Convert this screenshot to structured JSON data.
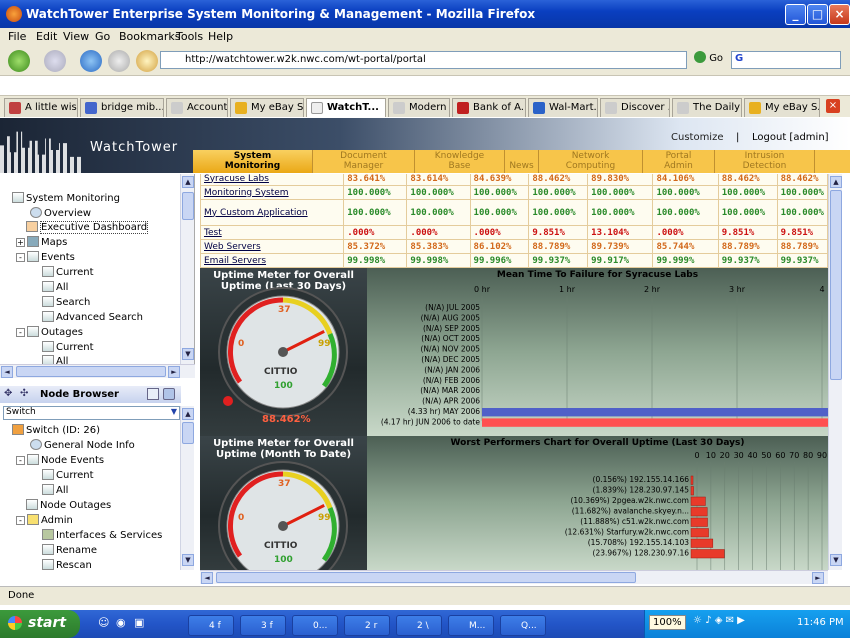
{
  "window": {
    "title": "WatchTower Enterprise System Monitoring & Management - Mozilla Firefox"
  },
  "menu": [
    "File",
    "Edit",
    "View",
    "Go",
    "Bookmarks",
    "Tools",
    "Help"
  ],
  "address": {
    "url": "http://watchtower.w2k.nwc.com/wt-portal/portal",
    "go_label": "Go",
    "search_letter": "G"
  },
  "tabs": [
    {
      "label": "A little wis..."
    },
    {
      "label": "bridge mib..."
    },
    {
      "label": "Accounts ..."
    },
    {
      "label": "My eBay S..."
    },
    {
      "label": "WatchT..."
    },
    {
      "label": "Modern Pi..."
    },
    {
      "label": "Bank of A..."
    },
    {
      "label": "Wal-Mart..."
    },
    {
      "label": "Discover ..."
    },
    {
      "label": "The Daily ..."
    },
    {
      "label": "My eBay S..."
    }
  ],
  "brand": {
    "name": "WatchTower",
    "customize": "Customize",
    "separator": "|",
    "logout": "Logout [admin]"
  },
  "nav": [
    {
      "l1": "System",
      "l2": "Monitoring",
      "active": true
    },
    {
      "l1": "Document",
      "l2": "Manager"
    },
    {
      "l1": "Knowledge",
      "l2": "Base"
    },
    {
      "l1": "",
      "l2": "News"
    },
    {
      "l1": "Network",
      "l2": "Computing"
    },
    {
      "l1": "Portal",
      "l2": "Admin"
    },
    {
      "l1": "Intrusion",
      "l2": "Detection"
    }
  ],
  "tree1": {
    "root": "System Monitoring",
    "overview": "Overview",
    "exec": "Executive Dashboard",
    "maps": "Maps",
    "events": "Events",
    "ev_current": "Current",
    "ev_all": "All",
    "ev_search": "Search",
    "ev_adv": "Advanced Search",
    "outages": "Outages",
    "out_current": "Current",
    "out_all": "All"
  },
  "node_browser": {
    "title": "Node Browser",
    "switch_value": "Switch",
    "node": "Switch (ID: 26)",
    "info": "General Node Info",
    "events": "Node Events",
    "ev_current": "Current",
    "ev_all": "All",
    "outages": "Node Outages",
    "admin": "Admin",
    "ifaces": "Interfaces & Services",
    "rename": "Rename",
    "rescan": "Rescan"
  },
  "availability": [
    {
      "name": "Syracuse Labs",
      "vals": [
        "83.641%",
        "83.614%",
        "84.639%",
        "88.462%",
        "89.830%",
        "84.106%",
        "88.462%",
        "88.462%"
      ],
      "cls": [
        "o",
        "o",
        "o",
        "o",
        "o",
        "o",
        "o",
        "o"
      ]
    },
    {
      "name": "Monitoring System",
      "vals": [
        "100.000%",
        "100.000%",
        "100.000%",
        "100.000%",
        "100.000%",
        "100.000%",
        "100.000%",
        "100.000%"
      ],
      "cls": [
        "g",
        "g",
        "g",
        "g",
        "g",
        "g",
        "g",
        "g"
      ]
    },
    {
      "name": "My Custom Application",
      "vals": [
        "100.000%",
        "100.000%",
        "100.000%",
        "100.000%",
        "100.000%",
        "100.000%",
        "100.000%",
        "100.000%"
      ],
      "cls": [
        "g",
        "g",
        "g",
        "g",
        "g",
        "g",
        "g",
        "g"
      ]
    },
    {
      "name": "Test",
      "vals": [
        ".000%",
        ".000%",
        ".000%",
        "9.851%",
        "13.104%",
        ".000%",
        "9.851%",
        "9.851%"
      ],
      "cls": [
        "r",
        "r",
        "r",
        "r",
        "r",
        "r",
        "r",
        "r"
      ]
    },
    {
      "name": "Web Servers",
      "vals": [
        "85.372%",
        "85.383%",
        "86.102%",
        "88.789%",
        "89.739%",
        "85.744%",
        "88.789%",
        "88.789%"
      ],
      "cls": [
        "o",
        "o",
        "o",
        "o",
        "o",
        "o",
        "o",
        "o"
      ]
    },
    {
      "name": "Email Servers",
      "vals": [
        "99.998%",
        "99.998%",
        "99.996%",
        "99.937%",
        "99.917%",
        "99.999%",
        "99.937%",
        "99.937%"
      ],
      "cls": [
        "g",
        "g",
        "g",
        "g",
        "g",
        "g",
        "g",
        "g"
      ]
    }
  ],
  "meter1": {
    "title": "Uptime Meter for Overall Uptime (Last 30 Days)",
    "value": "88.462%",
    "brand": "CITTIO",
    "marks": [
      "0",
      "37",
      "99",
      "100"
    ],
    "needle_pct": 88.462
  },
  "meter2": {
    "title": "Uptime Meter for Overall Uptime (Month To Date)",
    "brand": "CITTIO",
    "marks": [
      "0",
      "37",
      "99",
      "100"
    ],
    "needle_pct": 88.462
  },
  "chart_data": [
    {
      "type": "bar",
      "title": "Mean Time To Failure for Syracuse Labs",
      "x_ticks": [
        "0 hr",
        "1 hr",
        "2 hr",
        "3 hr",
        "4"
      ],
      "categories": [
        "(N/A) JUL 2005",
        "(N/A) AUG 2005",
        "(N/A) SEP 2005",
        "(N/A) OCT 2005",
        "(N/A) NOV 2005",
        "(N/A) DEC 2005",
        "(N/A) JAN 2006",
        "(N/A) FEB 2006",
        "(N/A) MAR 2006",
        "(N/A) APR 2006",
        "(4.33 hr) MAY 2006",
        "(4.17 hr) JUN 2006 to date"
      ],
      "values": [
        0,
        0,
        0,
        0,
        0,
        0,
        0,
        0,
        0,
        0,
        4.33,
        4.17
      ],
      "xlim": [
        0,
        4
      ],
      "colors": [
        "#5060c8",
        "#ff5050"
      ]
    },
    {
      "type": "bar",
      "title": "Worst Performers Chart for Overall Uptime (Last 30 Days)",
      "x_ticks": [
        "0",
        "10",
        "20",
        "30",
        "40",
        "50",
        "60",
        "70",
        "80",
        "90"
      ],
      "categories": [
        "(0.156%) 192.155.14.166",
        "(1.839%) 128.230.97.145",
        "(10.369%) 2pgea.w2k.nwc.com",
        "(11.682%) avalanche.skyey.n...",
        "(11.888%) c51.w2k.nwc.com",
        "(12.631%) Starfury.w2k.nwc.com",
        "(15.708%) 192.155.14.103",
        "(23.967%) 128.230.97.16"
      ],
      "values": [
        0.156,
        1.839,
        10.369,
        11.682,
        11.888,
        12.631,
        15.708,
        23.967
      ],
      "xlim": [
        0,
        90
      ],
      "color": "#e83a2a"
    }
  ],
  "status": {
    "text": "Done"
  },
  "taskbar": {
    "start": "start",
    "items": [
      "4 f",
      "3 f",
      "0...",
      "2 r",
      "2 \\",
      "M...",
      "Q..."
    ],
    "zoom": "100%",
    "clock": "11:46 PM"
  }
}
